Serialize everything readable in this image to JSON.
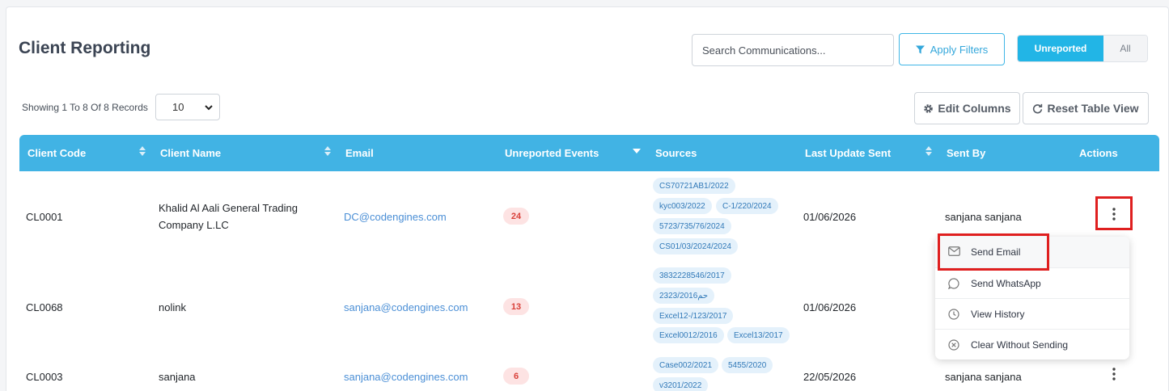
{
  "page": {
    "title": "Client Reporting",
    "search_placeholder": "Search Communications...",
    "apply_filters_label": "Apply Filters",
    "toggle": {
      "active": "Unreported",
      "inactive": "All"
    },
    "showing_text": "Showing 1 To 8 Of 8 Records",
    "page_size": "10",
    "edit_columns_label": "Edit Columns",
    "reset_view_label": "Reset Table View"
  },
  "table": {
    "columns": [
      "Client Code",
      "Client Name",
      "Email",
      "Unreported Events",
      "Sources",
      "Last Update Sent",
      "Sent By",
      "Actions"
    ],
    "rows": [
      {
        "code": "CL0001",
        "name": "Khalid Al Aali General Trading Company L.LC",
        "email": "DC@codengines.com",
        "events": "24",
        "sources": [
          "CS70721AB1/2022",
          "kyc003/2022",
          "C-1/220/2024",
          "5723/735/76/2024",
          "CS01/03/2024/2024"
        ],
        "last_update": "01/06/2026",
        "sent_by": "sanjana sanjana"
      },
      {
        "code": "CL0068",
        "name": "nolink",
        "email": "sanjana@codengines.com",
        "events": "13",
        "sources": [
          "3832228546/2017",
          "2323/2016حم",
          "Excel12-/123/2017",
          "Excel0012/2016",
          "Excel13/2017"
        ],
        "last_update": "01/06/2026",
        "sent_by": ""
      },
      {
        "code": "CL0003",
        "name": "sanjana",
        "email": "sanjana@codengines.com",
        "events": "6",
        "sources": [
          "Case002/2021",
          "5455/2020",
          "v3201/2022"
        ],
        "last_update": "22/05/2026",
        "sent_by": "sanjana sanjana"
      }
    ]
  },
  "menu": {
    "items": [
      {
        "label": "Send Email",
        "icon": "mail-icon"
      },
      {
        "label": "Send WhatsApp",
        "icon": "chat-bubble-icon"
      },
      {
        "label": "View History",
        "icon": "clock-icon"
      },
      {
        "label": "Clear Without Sending",
        "icon": "x-circle-icon"
      }
    ]
  },
  "colors": {
    "accent": "#41b3e4",
    "highlight": "#df1f1f",
    "badge_bg": "#fde3e3",
    "badge_text": "#d9423b",
    "chip_bg": "#e4f1fb",
    "link": "#4b8fd6"
  }
}
